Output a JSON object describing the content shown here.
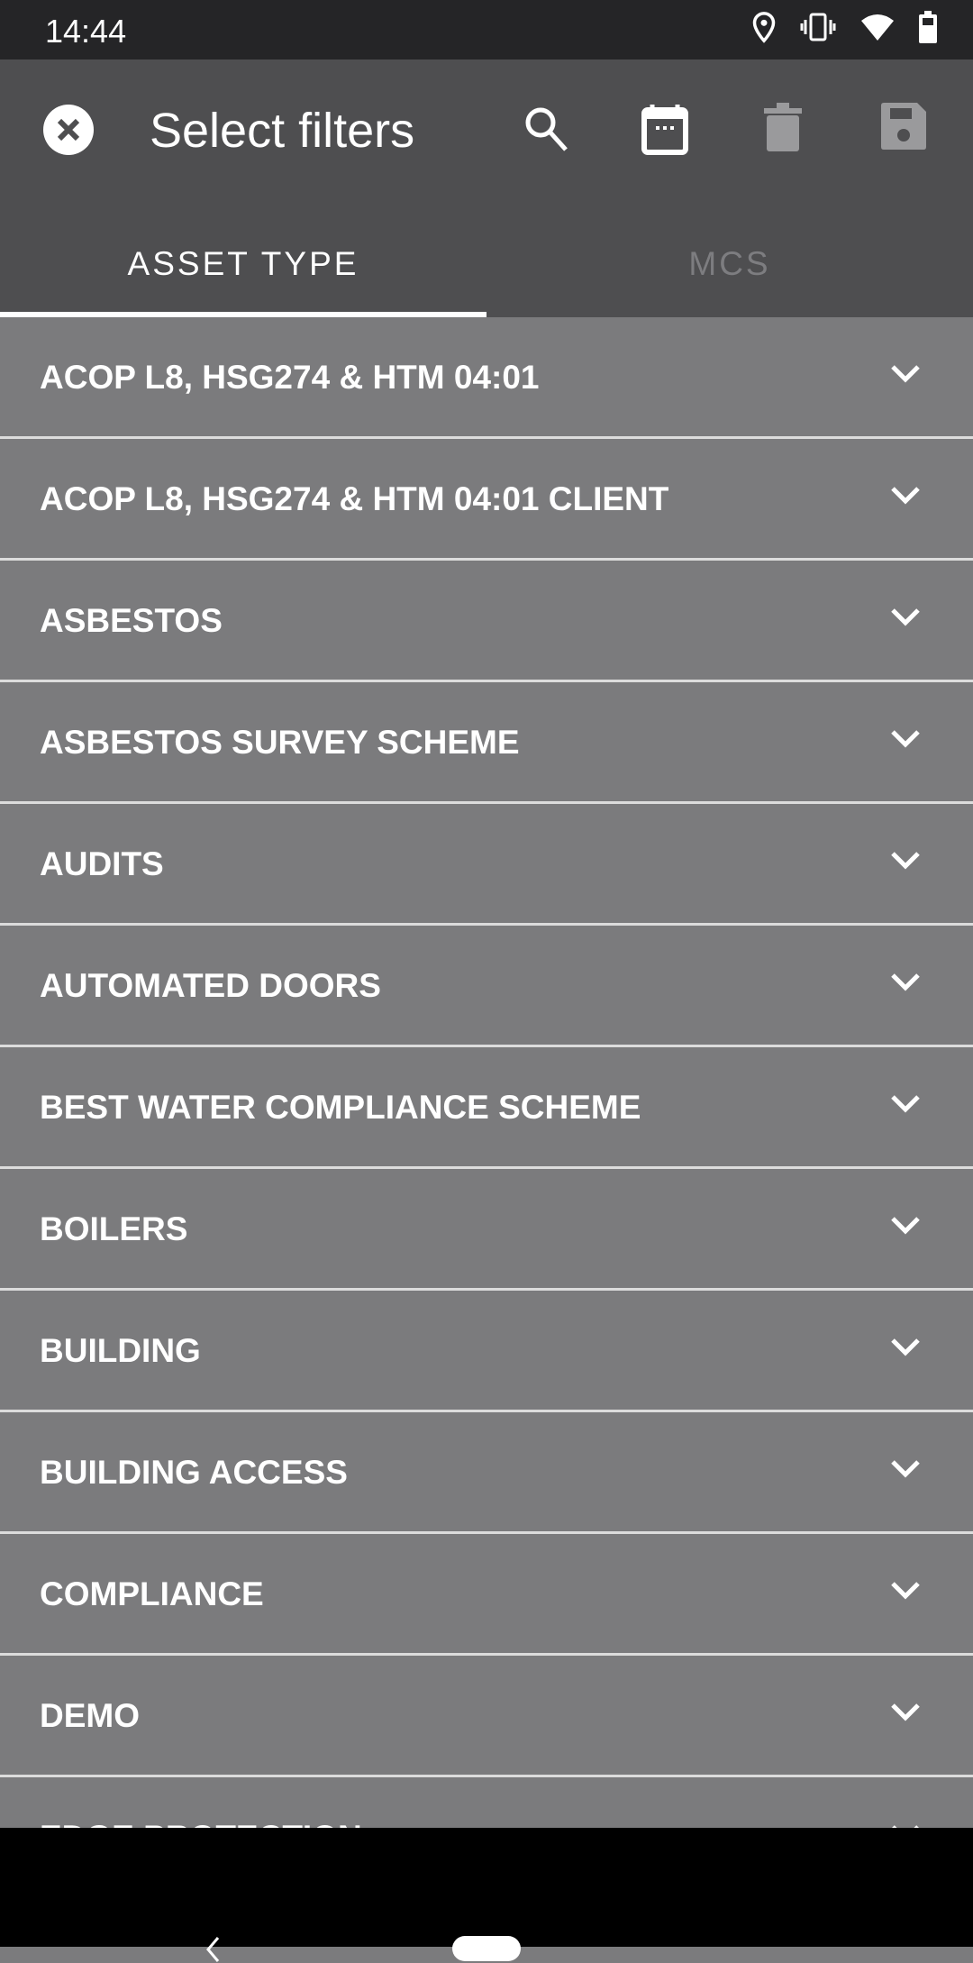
{
  "status_bar": {
    "time": "14:44",
    "icons": [
      "location-icon",
      "vibrate-icon",
      "wifi-icon",
      "battery-icon"
    ]
  },
  "app_bar": {
    "title": "Select filters",
    "actions": [
      "search-icon",
      "calendar-icon",
      "delete-icon",
      "save-icon"
    ]
  },
  "tabs": [
    {
      "label": "ASSET TYPE",
      "selected": true
    },
    {
      "label": "MCS",
      "selected": false
    }
  ],
  "items": [
    "ACOP L8, HSG274 & HTM 04:01",
    "ACOP L8, HSG274 & HTM 04:01 CLIENT",
    "ASBESTOS",
    "ASBESTOS SURVEY SCHEME",
    "AUDITS",
    "AUTOMATED DOORS",
    "BEST WATER COMPLIANCE SCHEME",
    "BOILERS",
    "BUILDING",
    "BUILDING ACCESS",
    "COMPLIANCE",
    "DEMO",
    "EDGE PROTECTION"
  ],
  "colors": {
    "status_bar": "#252527",
    "app_bar": "#4e4e50",
    "list_bg": "#7b7b7d",
    "divider": "#dcdcdc",
    "disabled_icon": "#9a9a9c"
  }
}
